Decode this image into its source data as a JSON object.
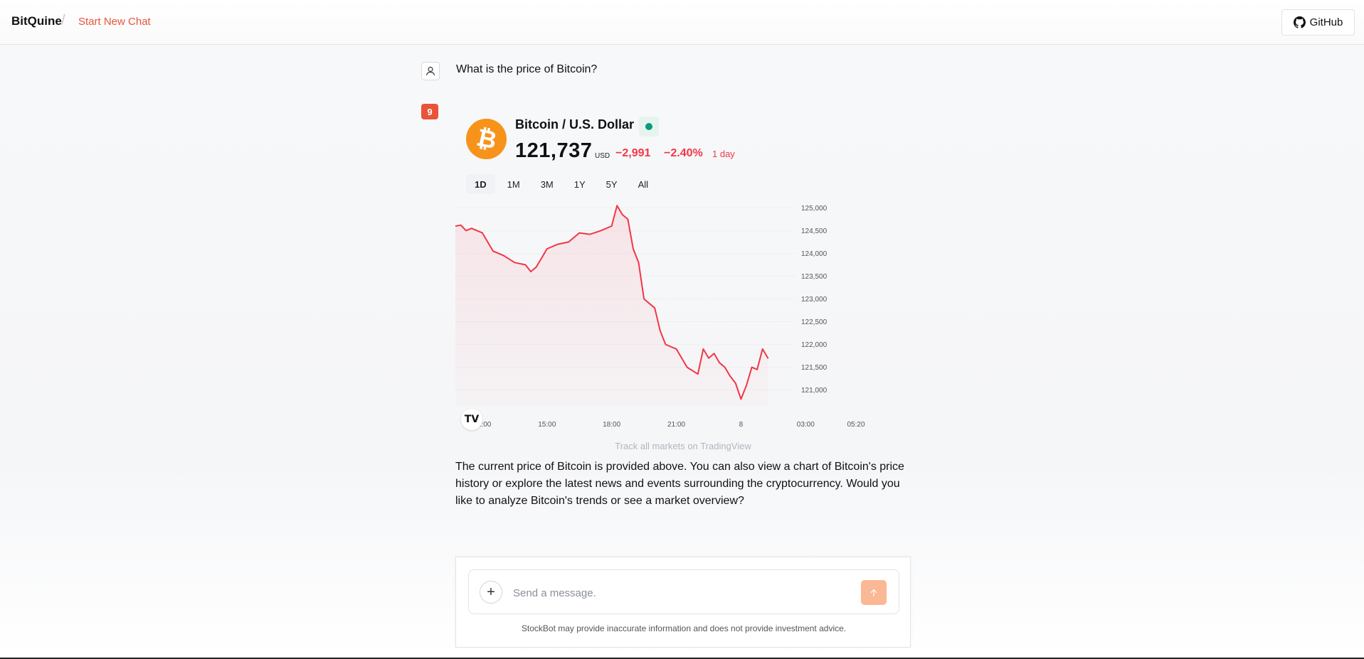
{
  "header": {
    "brand": "BitQuine",
    "separator": "/",
    "new_chat_label": "Start New Chat",
    "github_label": "GitHub",
    "github_icon": "github-icon"
  },
  "conversation": {
    "user_message": "What is the price of Bitcoin?",
    "user_icon": "user-icon",
    "bot_badge": "9",
    "answer": "The current price of Bitcoin is provided above. You can also view a chart of Bitcoin's price history or explore the latest news and events surrounding the cryptocurrency. Would you like to analyze Bitcoin's trends or see a market overview?"
  },
  "widget": {
    "pair_name": "Bitcoin / U.S. Dollar",
    "logo_icon": "bitcoin-logo-icon",
    "price": "121,737",
    "currency": "USD",
    "change": "−2,991",
    "change_pct": "−2.40%",
    "period": "1 day",
    "ranges": [
      "1D",
      "1M",
      "3M",
      "1Y",
      "5Y",
      "All"
    ],
    "active_range": "1D",
    "tradingview_link": "Track all markets on TradingView",
    "colors": {
      "line": "#f23645",
      "live": "#089981",
      "bitcoin": "#f7931a"
    }
  },
  "chart_data": {
    "type": "area",
    "title": "",
    "xlabel": "",
    "ylabel": "",
    "x_ticks": [
      "12:00",
      "15:00",
      "18:00",
      "21:00",
      "8",
      "03:00",
      "05:20"
    ],
    "y_ticks": [
      "121,000",
      "121,500",
      "122,000",
      "122,500",
      "123,000",
      "123,500",
      "124,000",
      "124,500",
      "125,000"
    ],
    "ylim": [
      120650,
      125100
    ],
    "x": [
      "10:45",
      "11:00",
      "11:15",
      "11:30",
      "12:00",
      "12:30",
      "13:00",
      "13:30",
      "14:00",
      "14:15",
      "14:30",
      "15:00",
      "15:30",
      "16:00",
      "16:30",
      "17:00",
      "17:30",
      "18:00",
      "18:15",
      "18:30",
      "18:45",
      "19:00",
      "19:15",
      "19:30",
      "20:00",
      "20:15",
      "20:30",
      "21:00",
      "21:30",
      "22:00",
      "22:15",
      "22:30",
      "22:45",
      "23:00",
      "23:15",
      "23:30",
      "23:45",
      "00:00",
      "00:15",
      "00:30",
      "00:45",
      "01:00",
      "01:15"
    ],
    "series": [
      {
        "values": [
          124600,
          124620,
          124500,
          124550,
          124450,
          124050,
          123950,
          123800,
          123750,
          123600,
          123700,
          124100,
          124200,
          124250,
          124450,
          124420,
          124500,
          124600,
          125050,
          124850,
          124750,
          124100,
          123800,
          123000,
          122800,
          122300,
          122000,
          121900,
          121500,
          121350,
          121900,
          121700,
          121800,
          121600,
          121500,
          121300,
          121150,
          120800,
          121100,
          121500,
          121450,
          121900,
          121700
        ]
      }
    ]
  },
  "composer": {
    "placeholder": "Send a message.",
    "plus_icon": "plus-icon",
    "send_icon": "arrow-up-icon",
    "disclaimer": "StockBot may provide inaccurate information and does not provide investment advice."
  }
}
